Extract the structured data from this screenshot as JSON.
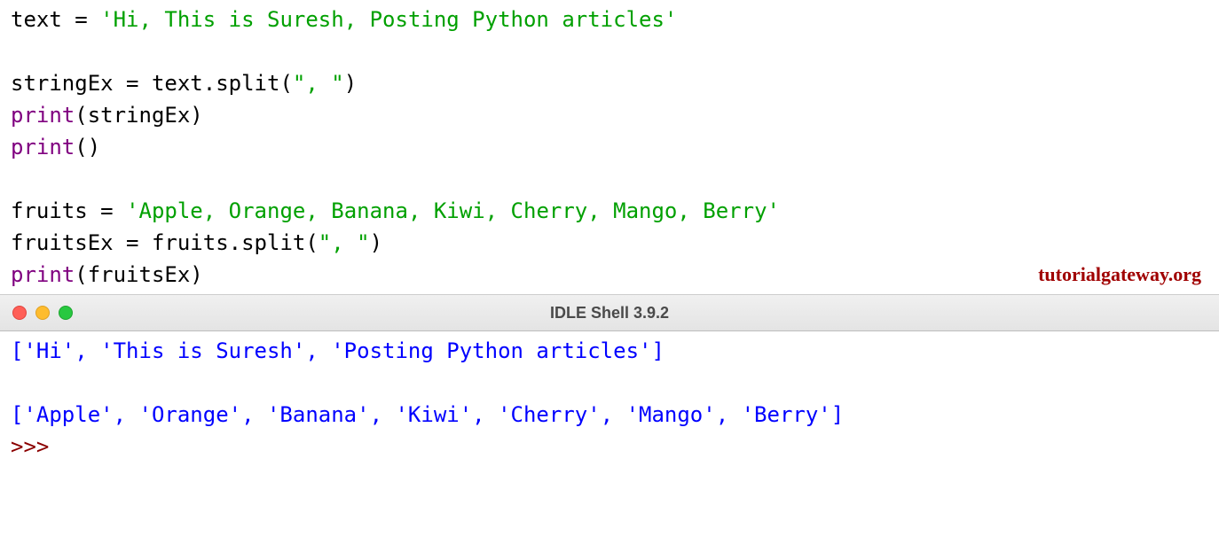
{
  "code": {
    "line1": {
      "var": "text",
      "eq": " = ",
      "str": "'Hi, This is Suresh, Posting Python articles'"
    },
    "line3": {
      "var": "stringEx",
      "eq": " = ",
      "call": "text.split(",
      "arg": "\", \"",
      "close": ")"
    },
    "line4": {
      "fn": "print",
      "open": "(",
      "arg": "stringEx",
      "close": ")"
    },
    "line5": {
      "fn": "print",
      "open": "()",
      "arg": "",
      "close": ""
    },
    "line7": {
      "var": "fruits",
      "eq": " = ",
      "str": "'Apple, Orange, Banana, Kiwi, Cherry, Mango, Berry'"
    },
    "line8": {
      "var": "fruitsEx",
      "eq": " = ",
      "call": "fruits.split(",
      "arg": "\", \"",
      "close": ")"
    },
    "line9": {
      "fn": "print",
      "open": "(",
      "arg": "fruitsEx",
      "close": ")"
    }
  },
  "watermark": "tutorialgateway.org",
  "titlebar": {
    "title": "IDLE Shell 3.9.2"
  },
  "shell": {
    "out1": "['Hi', 'This is Suresh', 'Posting Python articles']",
    "blank": " ",
    "out2": "['Apple', 'Orange', 'Banana', 'Kiwi', 'Cherry', 'Mango', 'Berry']",
    "prompt": ">>> "
  }
}
